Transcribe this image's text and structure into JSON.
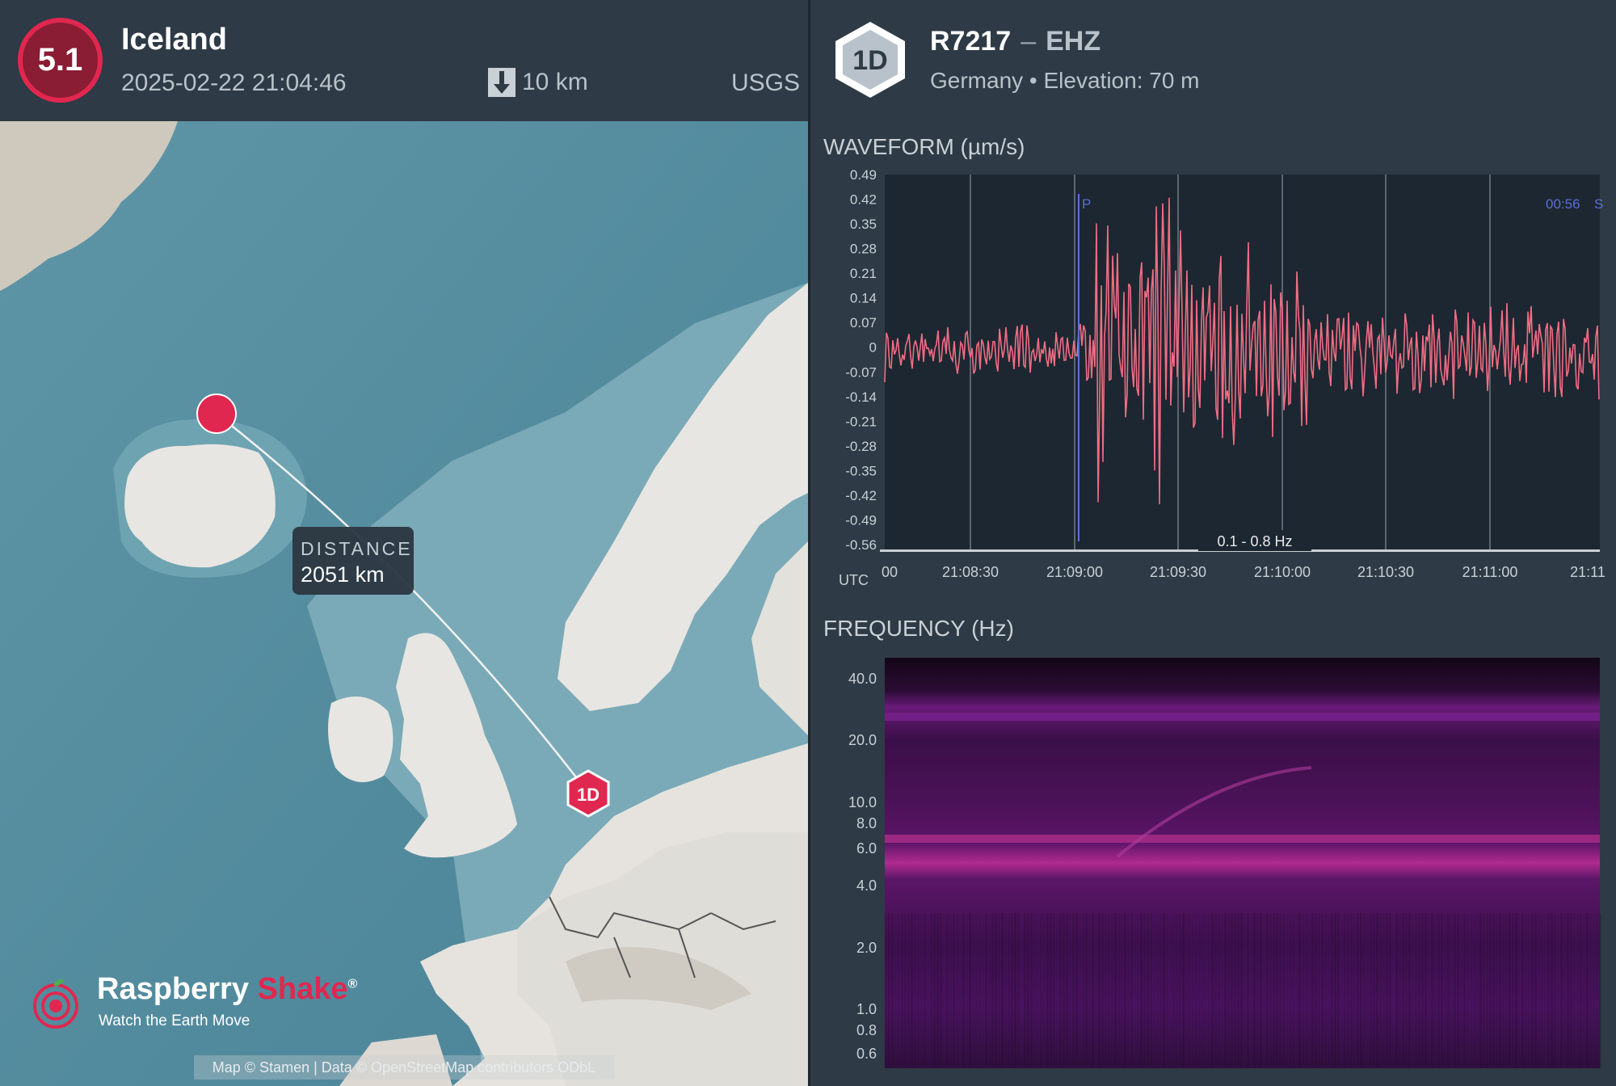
{
  "event": {
    "magnitude": "5.1",
    "title": "Iceland",
    "datetime": "2025-02-22 21:04:46",
    "depth": "10 km",
    "source": "USGS",
    "depth_icon": "arrow-down-icon"
  },
  "map": {
    "distance_label": "DISTANCE",
    "distance_value": "2051 km",
    "station_marker": "1D",
    "attribution": "Map © Stamen | Data © OpenStreetMap contributors ODbL"
  },
  "logo": {
    "name_white": "Raspberry",
    "name_red": "Shake",
    "registered": "®",
    "tagline": "Watch the Earth Move"
  },
  "station": {
    "badge": "1D",
    "code": "R7217",
    "separator": "–",
    "channel": "EHZ",
    "subtitle": "Germany • Elevation: 70 m"
  },
  "waveform": {
    "title": "WAVEFORM (µm/s)",
    "filter": "0.1 - 0.8 Hz",
    "timezone_label": "UTC",
    "p_label": "P",
    "right_time": "00:56",
    "right_phase": "S",
    "first_tick": "00",
    "last_tick": "21:11",
    "y_ticks": [
      "0.49",
      "0.42",
      "0.35",
      "0.28",
      "0.21",
      "0.14",
      "0.07",
      "0",
      "-0.07",
      "-0.14",
      "-0.21",
      "-0.28",
      "-0.35",
      "-0.42",
      "-0.49",
      "-0.56"
    ],
    "x_ticks": [
      "21:08:30",
      "21:09:00",
      "21:09:30",
      "21:10:00",
      "21:10:30",
      "21:11:00"
    ],
    "trace_color": "#f06d84"
  },
  "spectrogram": {
    "title": "FREQUENCY (Hz)",
    "y_ticks": [
      "40.0",
      "20.0",
      "10.0",
      "8.0",
      "6.0",
      "4.0",
      "2.0",
      "1.0",
      "0.8",
      "0.6"
    ]
  }
}
